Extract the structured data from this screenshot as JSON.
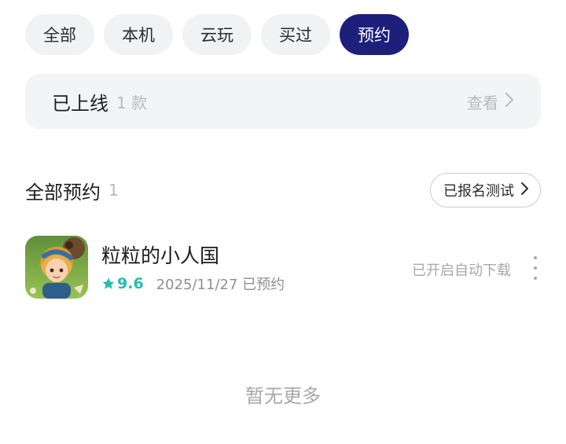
{
  "filters": {
    "tabs": [
      {
        "label": "全部"
      },
      {
        "label": "本机"
      },
      {
        "label": "云玩"
      },
      {
        "label": "买过"
      },
      {
        "label": "预约"
      }
    ],
    "active": "预约",
    "active_color": "#1d1f7a"
  },
  "online_card": {
    "title": "已上线",
    "count": "1 款",
    "view_label": "查看"
  },
  "reservations": {
    "title": "全部预约",
    "count": "1",
    "test_button_label": "已报名测试",
    "items": [
      {
        "name": "粒粒的小人国",
        "rating": "9.6",
        "reserve_info": "2025/11/27 已预约",
        "auto_download": "已开启自动下载",
        "rating_color": "#1fbfb1"
      }
    ]
  },
  "footer": {
    "no_more": "暂无更多"
  }
}
